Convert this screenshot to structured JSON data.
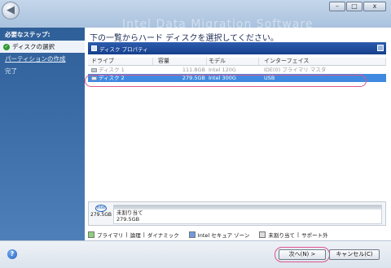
{
  "window": {
    "title_ghost": "Intel Data Migration Software",
    "minimize_label": "–",
    "maximize_label": "□",
    "close_label": "x"
  },
  "sidebar": {
    "header": "必要なステップ:",
    "items": [
      {
        "label": "ディスクの選択",
        "state": "current"
      },
      {
        "label": "パーティションの作成",
        "state": "link"
      },
      {
        "label": "完了",
        "state": "disabled"
      }
    ]
  },
  "main": {
    "instruction": "下の一覧からハード ディスクを選択してください。",
    "panel_title": "ディスク プロパティ",
    "columns": [
      "ドライブ",
      "容量",
      "モデル",
      "インターフェイス"
    ],
    "rows": [
      {
        "drive": "ディスク 1",
        "capacity": "111.8GB",
        "model": "Intel 120G",
        "interface": "IDE(0) プライマリ マスタ",
        "selected": false
      },
      {
        "drive": "ディスク 2",
        "capacity": "279.5GB",
        "model": "Intel 300G",
        "interface": "USB",
        "selected": true
      }
    ]
  },
  "partition": {
    "disk_icon_text": "intel",
    "disk_size": "279.5GB",
    "label": "未割り当て",
    "size": "279.5GB"
  },
  "legend": {
    "primary": "プライマリ",
    "logical": "論理",
    "dynamic": "ダイナミック",
    "intel_secure": "Intel セキュア ゾーン",
    "unallocated": "未割り当て",
    "unsupported": "サポート外",
    "separator": "|"
  },
  "footer": {
    "help_icon": "?",
    "next_label": "次へ(N) >",
    "cancel_label": "キャンセル(C)"
  },
  "colors": {
    "sidebar": "#3a6aa5",
    "selection": "#3f8ae0",
    "highlight": "#e0558e"
  }
}
